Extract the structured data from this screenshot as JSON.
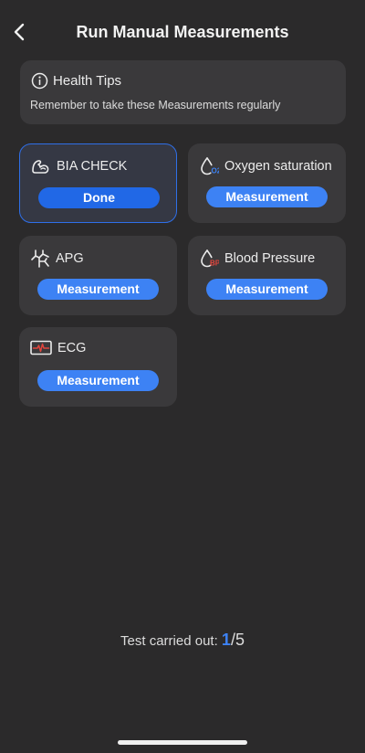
{
  "header": {
    "title": "Run Manual Measurements",
    "back_icon": "chevron-left-icon"
  },
  "health_tips": {
    "icon": "info-icon",
    "title": "Health Tips",
    "text": "Remember to take these Measurements regularly"
  },
  "cards": [
    {
      "name": "BIA CHECK",
      "icon": "bia-arm-icon",
      "button": "Done",
      "state": "done"
    },
    {
      "name": "Oxygen saturation",
      "icon": "o2-drop-icon",
      "icon_badge": "O2",
      "button": "Measurement",
      "state": "pending"
    },
    {
      "name": "APG",
      "icon": "apg-vessel-icon",
      "button": "Measurement",
      "state": "pending"
    },
    {
      "name": "Blood Pressure",
      "icon": "bp-drop-icon",
      "icon_badge": "BP",
      "button": "Measurement",
      "state": "pending"
    },
    {
      "name": "ECG",
      "icon": "ecg-monitor-icon",
      "button": "Measurement",
      "state": "pending"
    }
  ],
  "progress": {
    "label": "Test carried out: ",
    "done": "1",
    "total": "/5"
  },
  "colors": {
    "background": "#2b2a2b",
    "card": "#3a393b",
    "accent": "#3d82f4",
    "active_border": "#2f6fe8",
    "bp_red": "#e2453c",
    "o2_blue": "#3d82f4"
  }
}
